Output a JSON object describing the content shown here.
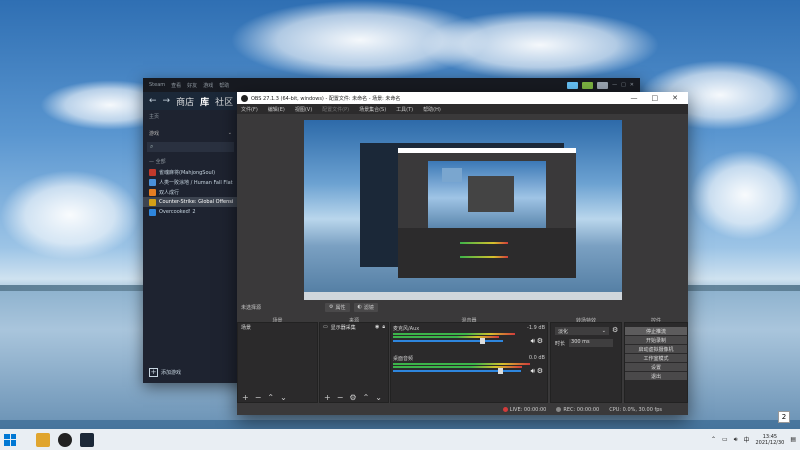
{
  "steam": {
    "menu": [
      "Steam",
      "查看",
      "好友",
      "游戏",
      "帮助"
    ],
    "nav": {
      "store": "商店",
      "library": "库",
      "community": "社区"
    },
    "home": "主页",
    "filter": "游戏",
    "section": "— 全部",
    "games": [
      {
        "name": "雀魂麻将(MahjongSoul)",
        "color": "#c0392b"
      },
      {
        "name": "人类一败涂地 / Human Fall Flat",
        "color": "#4a90d9"
      },
      {
        "name": "双人成行",
        "color": "#e67e22"
      },
      {
        "name": "Counter-Strike: Global Offensi",
        "color": "#d4a017",
        "selected": true
      },
      {
        "name": "Overcooked! 2",
        "color": "#2e86de"
      }
    ],
    "add_game": "添加游戏",
    "header_badges": [
      {
        "color": "#66c0f4"
      },
      {
        "color": "#7cb342"
      },
      {
        "color": "#9aa5b1"
      }
    ]
  },
  "obs": {
    "title": "OBS 27.1.3 (64-bit, windows) - 配置文件: 未命名 - 场景: 未命名",
    "menu": [
      "文件(F)",
      "编辑(E)",
      "视图(V)",
      "配置文件(P)",
      "场景集合(S)",
      "工具(T)",
      "帮助(H)"
    ],
    "toolbar_source": "未选择源",
    "toolbar_props": "属性",
    "toolbar_filters": "滤镜",
    "docks": {
      "scenes": {
        "title": "场景",
        "items": [
          "场景"
        ]
      },
      "sources": {
        "title": "来源",
        "items": [
          "显示器采集"
        ]
      },
      "mixer": {
        "title": "混音器",
        "channels": [
          {
            "name": "麦克风/Aux",
            "db": "-1.9 dB"
          },
          {
            "name": "桌面音频",
            "db": "0.0 dB"
          }
        ]
      },
      "transitions": {
        "title": "转场特效",
        "type": "淡化",
        "duration_label": "时长",
        "duration": "300 ms"
      },
      "controls": {
        "title": "控件",
        "buttons": [
          "停止推流",
          "开始录制",
          "启动虚拟摄像机",
          "工作室模式",
          "设置",
          "退出"
        ]
      }
    },
    "status": {
      "live": "LIVE: 00:00:00",
      "rec": "REC: 00:00:00",
      "cpu": "CPU: 0.0%, 30.00 fps"
    }
  },
  "taskbar": {
    "time": "13:45",
    "date": "2021/12/30",
    "ime": "中",
    "notification_count": "2"
  }
}
